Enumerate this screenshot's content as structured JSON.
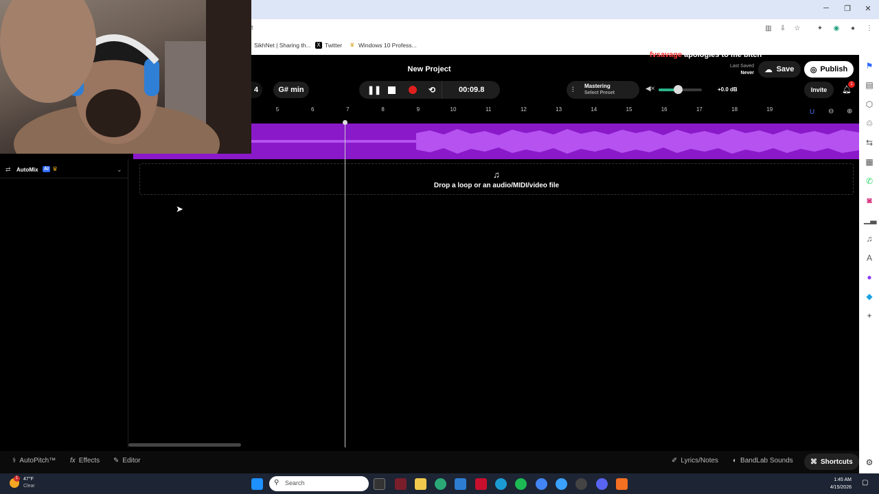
{
  "browser": {
    "window_controls": {
      "minimize": "─",
      "maximize": "❐",
      "close": "✕"
    },
    "bookmarks": [
      {
        "label": "SikhNet | Sharing th...",
        "icon": "sikhnet-icon"
      },
      {
        "label": "Twitter",
        "icon": "x-icon"
      },
      {
        "label": "Windows 10 Profess...",
        "icon": "crown-icon"
      }
    ],
    "address_fragment": "t"
  },
  "header": {
    "project_title": "New Project",
    "overlay_user": "fvsavage",
    "overlay_text": "apologies to me bitch",
    "last_saved_label": "Last Saved",
    "last_saved_value": "Never",
    "save_label": "Save",
    "publish_label": "Publish",
    "invite_label": "Invite",
    "notification_count": "1"
  },
  "transport": {
    "bpm_fragment": "4",
    "key": "G# min",
    "time": "00:09.8",
    "mastering_label": "Mastering",
    "mastering_preset": "Select Preset",
    "volume_db": "+0.0 dB",
    "volume_level": 0.45
  },
  "ruler": {
    "ticks": [
      "5",
      "6",
      "7",
      "8",
      "9",
      "10",
      "11",
      "12",
      "13",
      "14",
      "15",
      "16",
      "17",
      "18",
      "19"
    ]
  },
  "track_panel": {
    "automix_label": "AutoMix",
    "ai_badge": "AI"
  },
  "drop_zone": {
    "text": "Drop a loop or an audio/MIDI/video file"
  },
  "bottom_bar": {
    "autopitch": "AutoPitch™",
    "effects": "Effects",
    "editor": "Editor",
    "lyrics": "Lyrics/Notes",
    "sounds": "BandLab Sounds",
    "shortcuts": "Shortcuts"
  },
  "taskbar": {
    "weather_temp": "47°F",
    "weather_desc": "Clear",
    "weather_badge": "1",
    "search_placeholder": "Search",
    "time": "1:45 AM",
    "date": "4/15/2026"
  },
  "colors": {
    "accent": "#8a19c9",
    "record": "#e0201f",
    "overlay_red": "#ff3b3b"
  }
}
